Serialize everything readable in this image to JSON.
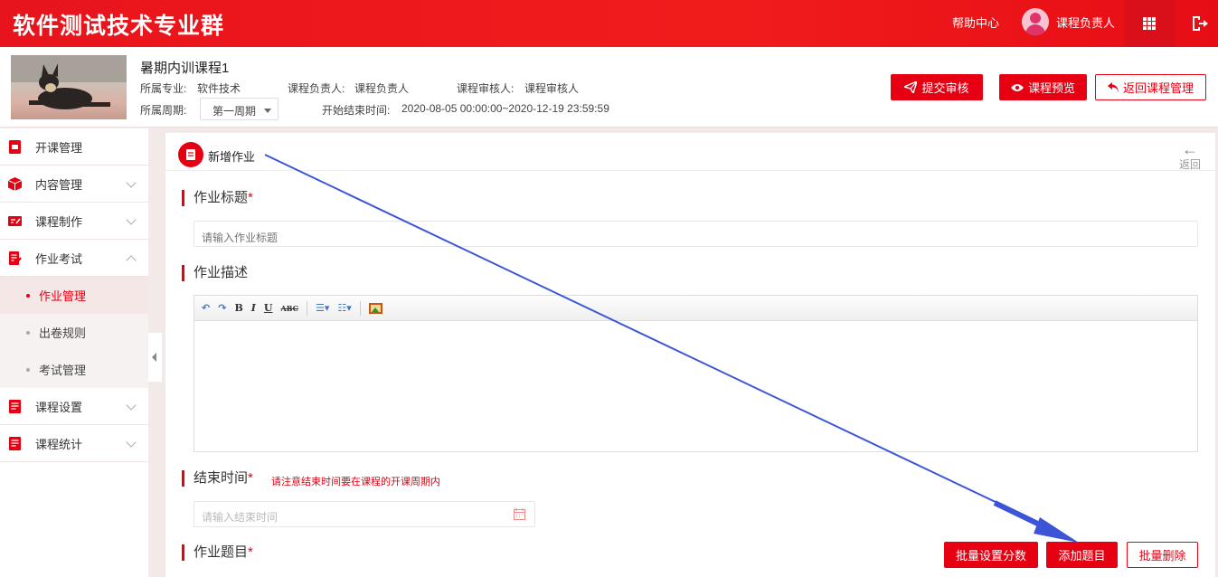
{
  "header": {
    "brand": "软件测试技术专业群",
    "help": "帮助中心",
    "user": "课程负责人"
  },
  "course": {
    "name": "暑期内训课程1",
    "major_label": "所属专业:",
    "major": "软件技术",
    "owner_label": "课程负责人:",
    "owner": "课程负责人",
    "reviewer_label": "课程审核人:",
    "reviewer": "课程审核人",
    "period_label": "所属周期:",
    "period_selected": "第一周期",
    "time_label": "开始结束时间:",
    "time_range": "2020-08-05 00:00:00~2020-12-19 23:59:59"
  },
  "actions": {
    "submit": "提交审核",
    "preview": "课程预览",
    "return": "返回课程管理"
  },
  "sidebar": {
    "items": [
      {
        "label": "开课管理"
      },
      {
        "label": "内容管理"
      },
      {
        "label": "课程制作"
      },
      {
        "label": "作业考试"
      },
      {
        "label": "课程设置"
      },
      {
        "label": "课程统计"
      }
    ],
    "sub": [
      {
        "label": "作业管理"
      },
      {
        "label": "出卷规则"
      },
      {
        "label": "考试管理"
      }
    ]
  },
  "panel": {
    "title": "新增作业",
    "back": "返回",
    "title_field_label": "作业标题",
    "title_placeholder": "请输入作业标题",
    "desc_label": "作业描述",
    "end_label": "结束时间",
    "end_hint": "请注意结束时间要在课程的开课周期内",
    "end_placeholder": "请输入结束时间",
    "questions_label": "作业题目",
    "required_mark": "*",
    "batch_score": "批量设置分数",
    "add_question": "添加题目",
    "batch_delete": "批量删除"
  },
  "editor_toolbar": {
    "bold": "B",
    "italic": "I",
    "underline": "U",
    "strike": "ABC"
  },
  "colors": {
    "brand_red": "#e60012",
    "annotation_arrow": "#3b55d6"
  }
}
